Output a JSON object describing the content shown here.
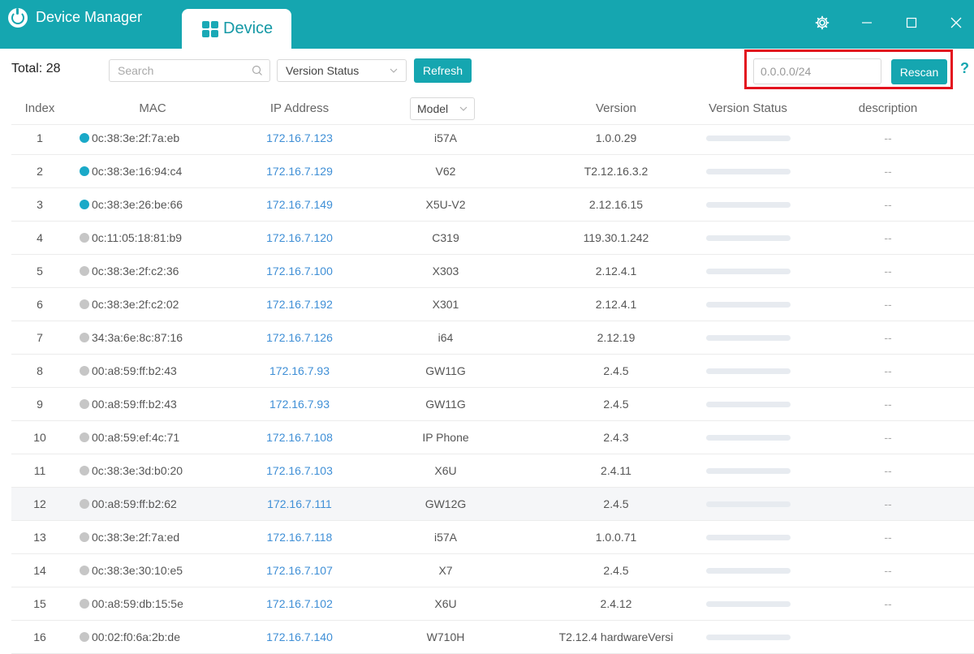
{
  "app": {
    "title": "Device Manager",
    "tab_label": "Device"
  },
  "colors": {
    "accent": "#15a6b0",
    "link": "#3f8fd6",
    "online_dot": "#1aa9c8",
    "offline_dot": "#c6c6c6",
    "highlight": "#e3121e"
  },
  "toolbar": {
    "total": "Total: 28",
    "search_placeholder": "Search",
    "version_status_select": "Version Status",
    "refresh_label": "Refresh",
    "ip_range_value": "0.0.0.0/24",
    "rescan_label": "Rescan",
    "help_label": "?"
  },
  "table": {
    "headers": {
      "index": "Index",
      "mac": "MAC",
      "ip": "IP Address",
      "model": "Model",
      "version": "Version",
      "version_status": "Version Status",
      "description": "description"
    },
    "rows": [
      {
        "index": "1",
        "mac": "0c:38:3e:2f:7a:eb",
        "ip": "172.16.7.123",
        "model": "i57A",
        "version": "1.0.0.29",
        "description": "--",
        "online": true
      },
      {
        "index": "2",
        "mac": "0c:38:3e:16:94:c4",
        "ip": "172.16.7.129",
        "model": "V62",
        "version": "T2.12.16.3.2",
        "description": "--",
        "online": true
      },
      {
        "index": "3",
        "mac": "0c:38:3e:26:be:66",
        "ip": "172.16.7.149",
        "model": "X5U-V2",
        "version": "2.12.16.15",
        "description": "--",
        "online": true
      },
      {
        "index": "4",
        "mac": "0c:11:05:18:81:b9",
        "ip": "172.16.7.120",
        "model": "C319",
        "version": "119.30.1.242",
        "description": "--",
        "online": false
      },
      {
        "index": "5",
        "mac": "0c:38:3e:2f:c2:36",
        "ip": "172.16.7.100",
        "model": "X303",
        "version": "2.12.4.1",
        "description": "--",
        "online": false
      },
      {
        "index": "6",
        "mac": "0c:38:3e:2f:c2:02",
        "ip": "172.16.7.192",
        "model": "X301",
        "version": "2.12.4.1",
        "description": "--",
        "online": false
      },
      {
        "index": "7",
        "mac": "34:3a:6e:8c:87:16",
        "ip": "172.16.7.126",
        "model": "i64",
        "version": "2.12.19",
        "description": "--",
        "online": false
      },
      {
        "index": "8",
        "mac": "00:a8:59:ff:b2:43",
        "ip": "172.16.7.93",
        "model": "GW11G",
        "version": "2.4.5",
        "description": "--",
        "online": false
      },
      {
        "index": "9",
        "mac": "00:a8:59:ff:b2:43",
        "ip": "172.16.7.93",
        "model": "GW11G",
        "version": "2.4.5",
        "description": "--",
        "online": false
      },
      {
        "index": "10",
        "mac": "00:a8:59:ef:4c:71",
        "ip": "172.16.7.108",
        "model": "IP Phone",
        "version": "2.4.3",
        "description": "--",
        "online": false
      },
      {
        "index": "11",
        "mac": "0c:38:3e:3d:b0:20",
        "ip": "172.16.7.103",
        "model": "X6U",
        "version": "2.4.11",
        "description": "--",
        "online": false
      },
      {
        "index": "12",
        "mac": "00:a8:59:ff:b2:62",
        "ip": "172.16.7.111",
        "model": "GW12G",
        "version": "2.4.5",
        "description": "--",
        "online": false
      },
      {
        "index": "13",
        "mac": "0c:38:3e:2f:7a:ed",
        "ip": "172.16.7.118",
        "model": "i57A",
        "version": "1.0.0.71",
        "description": "--",
        "online": false
      },
      {
        "index": "14",
        "mac": "0c:38:3e:30:10:e5",
        "ip": "172.16.7.107",
        "model": "X7",
        "version": "2.4.5",
        "description": "--",
        "online": false
      },
      {
        "index": "15",
        "mac": "00:a8:59:db:15:5e",
        "ip": "172.16.7.102",
        "model": "X6U",
        "version": "2.4.12",
        "description": "--",
        "online": false
      },
      {
        "index": "16",
        "mac": "00:02:f0:6a:2b:de",
        "ip": "172.16.7.140",
        "model": "W710H",
        "version": "T2.12.4 hardwareVersi",
        "description": "",
        "online": false
      }
    ]
  }
}
